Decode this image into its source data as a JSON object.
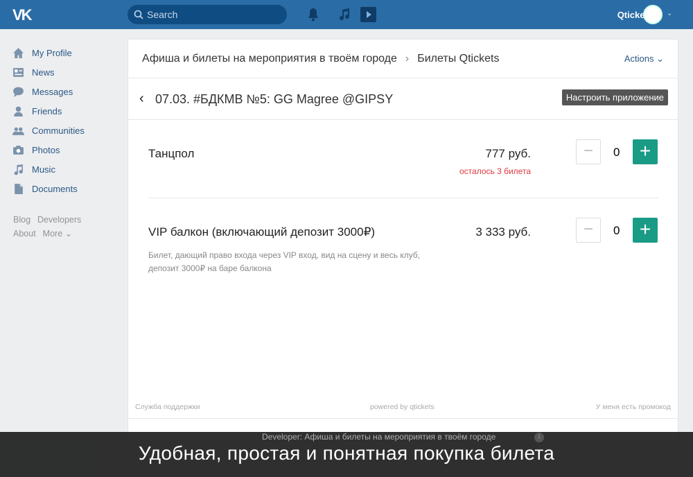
{
  "header": {
    "logo": "VK",
    "search_placeholder": "Search",
    "user_name": "Qtickets"
  },
  "sidebar": {
    "items": [
      {
        "label": "My Profile",
        "icon": "home-icon"
      },
      {
        "label": "News",
        "icon": "news-icon"
      },
      {
        "label": "Messages",
        "icon": "messages-icon"
      },
      {
        "label": "Friends",
        "icon": "friends-icon"
      },
      {
        "label": "Communities",
        "icon": "communities-icon"
      },
      {
        "label": "Photos",
        "icon": "camera-icon"
      },
      {
        "label": "Music",
        "icon": "music-icon"
      },
      {
        "label": "Documents",
        "icon": "document-icon"
      }
    ],
    "links": [
      "Blog",
      "Developers",
      "About",
      "More ⌄"
    ]
  },
  "app": {
    "breadcrumb": [
      "Афиша и билеты на мероприятия в твоём городе",
      "Билеты Qtickets"
    ],
    "actions": "Actions ⌄",
    "event_title": "07.03. #БДКМВ №5: GG Magree @GIPSY",
    "configure": "Настроить приложение",
    "tickets": [
      {
        "name": "Танцпол",
        "price": "777 руб.",
        "remaining": "осталось 3 билета",
        "qty": "0"
      },
      {
        "name": "VIP балкон (включающий депозит 3000₽)",
        "description": "Билет, дающий право входа через VIP вход, вид на сцену и весь клуб, депозит 3000₽ на баре балкона",
        "price": "3 333 руб.",
        "qty": "0"
      }
    ],
    "footer": {
      "support": "Служба поддержки",
      "powered": "powered by qtickets",
      "promo": "У меня есть промокод"
    },
    "developer": "Developer: Афиша и билеты на мероприятия в твоём городе"
  },
  "caption": "Удобная, простая и понятная покупка билета",
  "colors": {
    "header": "#2a6ca6",
    "accent": "#1a9b86",
    "warning": "#e0383e"
  }
}
